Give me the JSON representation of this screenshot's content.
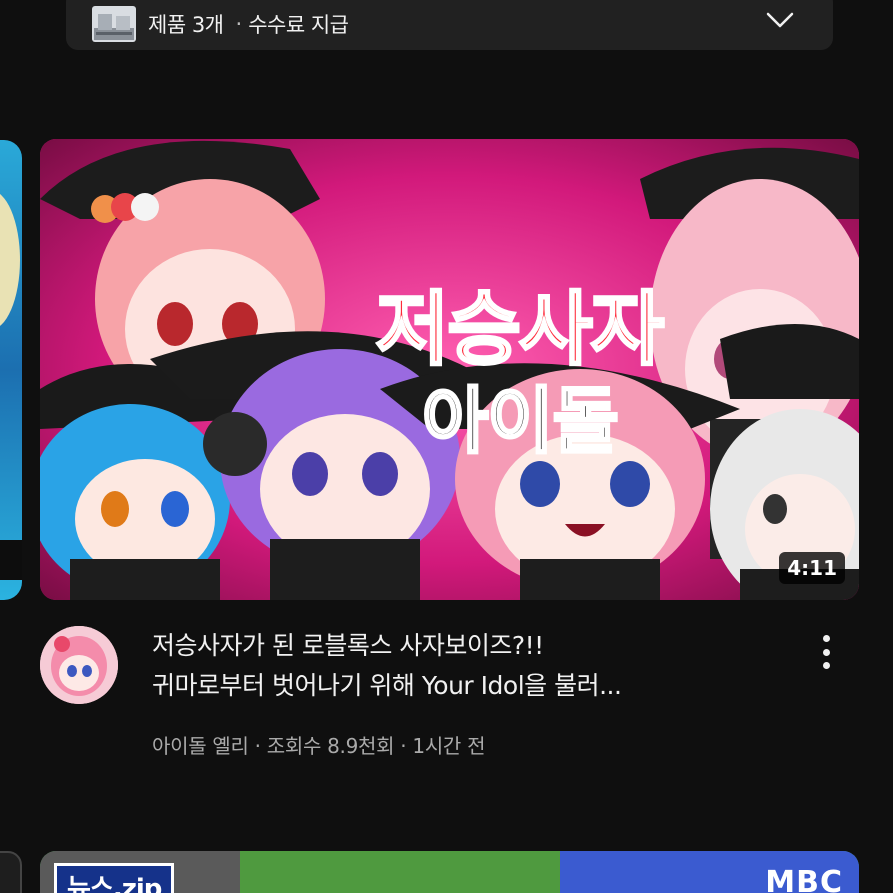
{
  "product_bar": {
    "count_text": "제품 3개",
    "separator": "·",
    "commission_text": "수수료 지급",
    "thumb_icon": "product-thumbnail",
    "expand_icon": "chevron-down-icon"
  },
  "video": {
    "thumbnail_text_line1": "저승사자",
    "thumbnail_text_line2": "아이돌",
    "duration": "4:11",
    "title_line1": "저승사자가 된 로블록스 사자보이즈?!!",
    "title_line2": "귀마로부터 벗어나기 위해 Your Idol을 불러...",
    "channel": "아이돌 옐리",
    "views": "조회수 8.9천회",
    "age": "1시간 전",
    "meta_sep": " · ",
    "more_icon": "more-vertical-icon"
  },
  "next_video": {
    "badge": "뉴스.zip",
    "logo": "MBC"
  },
  "colors": {
    "background": "#0f0f0f",
    "card": "#212121",
    "secondary_text": "#aaaaaa",
    "thumb_magenta": "#c21d74"
  }
}
